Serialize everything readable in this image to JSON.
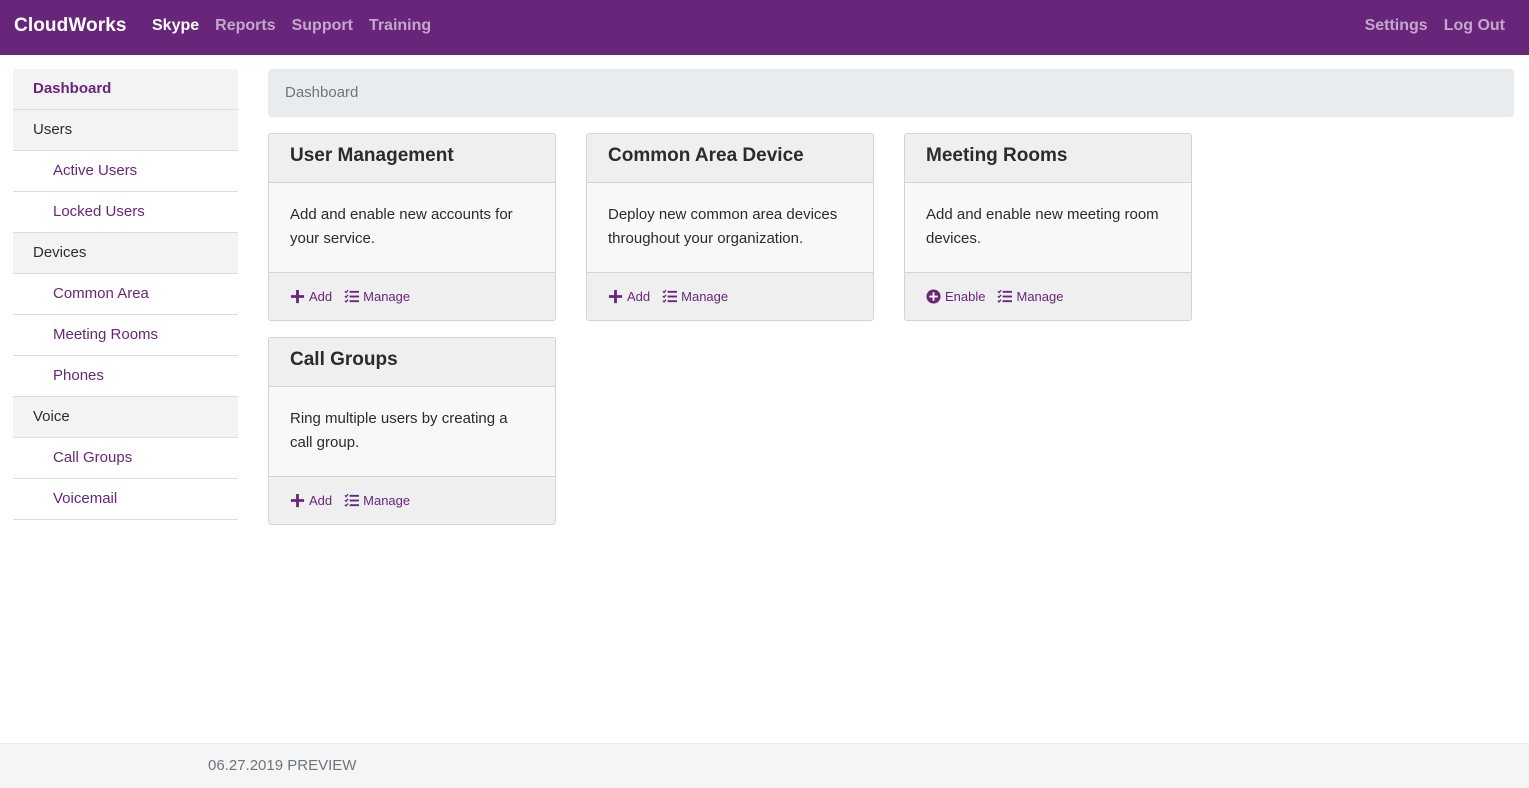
{
  "navbar": {
    "brand": "CloudWorks",
    "left_links": [
      {
        "label": "Skype",
        "active": true
      },
      {
        "label": "Reports",
        "active": false
      },
      {
        "label": "Support",
        "active": false
      },
      {
        "label": "Training",
        "active": false
      }
    ],
    "right_links": [
      {
        "label": "Settings"
      },
      {
        "label": "Log Out"
      }
    ]
  },
  "sidebar": {
    "items": [
      {
        "label": "Dashboard",
        "type": "section",
        "active": true
      },
      {
        "label": "Users",
        "type": "section"
      },
      {
        "label": "Active Users",
        "type": "sub"
      },
      {
        "label": "Locked Users",
        "type": "sub"
      },
      {
        "label": "Devices",
        "type": "section"
      },
      {
        "label": "Common Area",
        "type": "sub"
      },
      {
        "label": "Meeting Rooms",
        "type": "sub"
      },
      {
        "label": "Phones",
        "type": "sub"
      },
      {
        "label": "Voice",
        "type": "section"
      },
      {
        "label": "Call Groups",
        "type": "sub"
      },
      {
        "label": "Voicemail",
        "type": "sub"
      }
    ]
  },
  "breadcrumb": {
    "label": "Dashboard"
  },
  "cards": [
    {
      "title": "User Management",
      "description": "Add and enable new accounts for your service.",
      "actions": [
        {
          "label": "Add",
          "icon": "plus-icon"
        },
        {
          "label": "Manage",
          "icon": "checklist-icon"
        }
      ]
    },
    {
      "title": "Common Area Device",
      "description": "Deploy new common area devices throughout your organization.",
      "actions": [
        {
          "label": "Add",
          "icon": "plus-icon"
        },
        {
          "label": "Manage",
          "icon": "checklist-icon"
        }
      ]
    },
    {
      "title": "Meeting Rooms",
      "description": "Add and enable new meeting room devices.",
      "actions": [
        {
          "label": "Enable",
          "icon": "plus-circle-icon"
        },
        {
          "label": "Manage",
          "icon": "checklist-icon"
        }
      ]
    },
    {
      "title": "Call Groups",
      "description": "Ring multiple users by creating a call group.",
      "actions": [
        {
          "label": "Add",
          "icon": "plus-icon"
        },
        {
          "label": "Manage",
          "icon": "checklist-icon"
        }
      ]
    }
  ],
  "footer": {
    "text": "06.27.2019 PREVIEW"
  },
  "colors": {
    "brand": "#68267a",
    "nav_inactive": "#c6a6cf"
  }
}
